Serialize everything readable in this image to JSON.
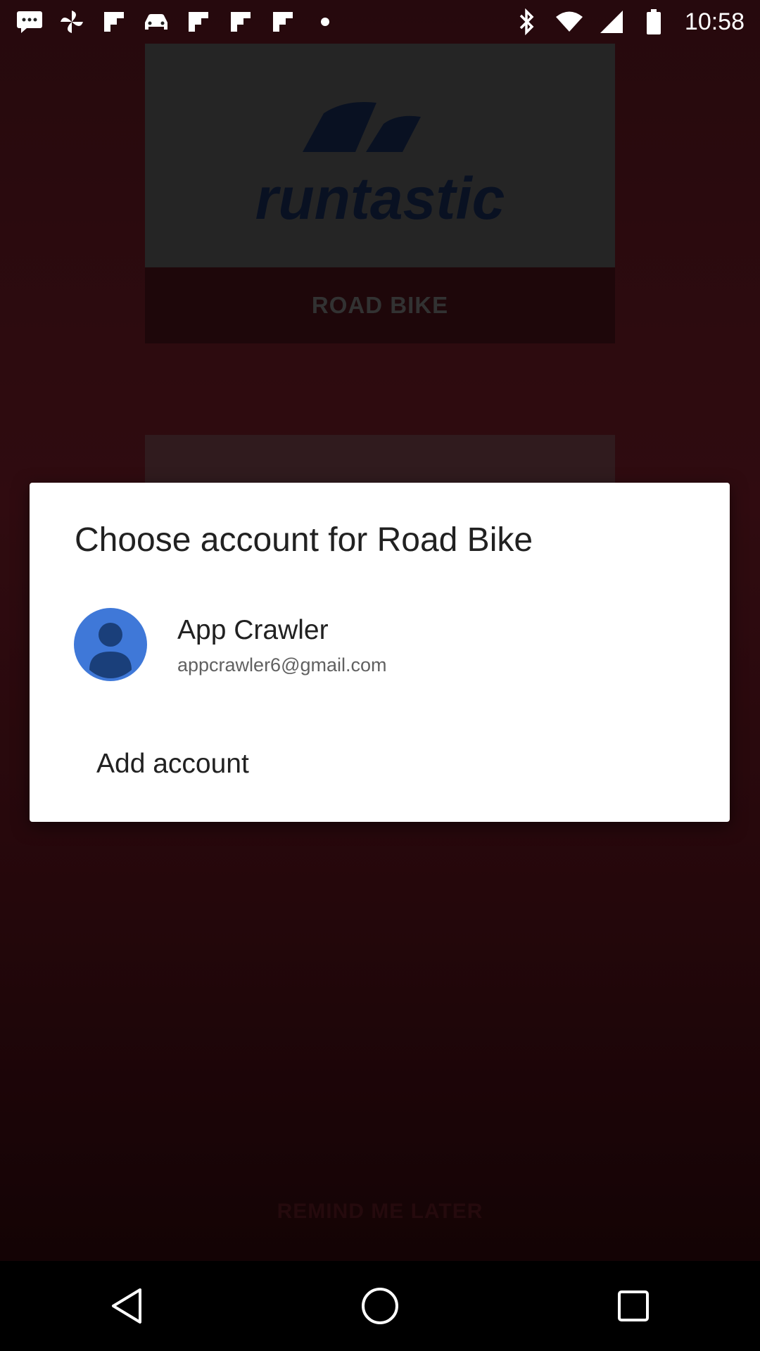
{
  "status_bar": {
    "time": "10:58",
    "left_icons": [
      "message-icon",
      "pinwheel-icon",
      "flipboard-icon",
      "car-icon",
      "flipboard-icon",
      "flipboard-icon",
      "flipboard-icon",
      "dot-icon"
    ],
    "right_icons": [
      "bluetooth-icon",
      "wifi-icon",
      "signal-icon",
      "battery-icon"
    ]
  },
  "background_app": {
    "logo_text": "runtastic",
    "road_bike_label": "ROAD BIKE",
    "remind_label": "REMIND ME LATER",
    "brand_color": "#0f1b35",
    "background_color": "#4a1219"
  },
  "dialog": {
    "title": "Choose account for Road Bike",
    "account": {
      "name": "App Crawler",
      "email": "appcrawler6@gmail.com",
      "avatar_color": "#3f78d8"
    },
    "add_account_label": "Add account"
  },
  "nav_bar": {
    "buttons": [
      "back-icon",
      "home-icon",
      "recents-icon"
    ]
  }
}
